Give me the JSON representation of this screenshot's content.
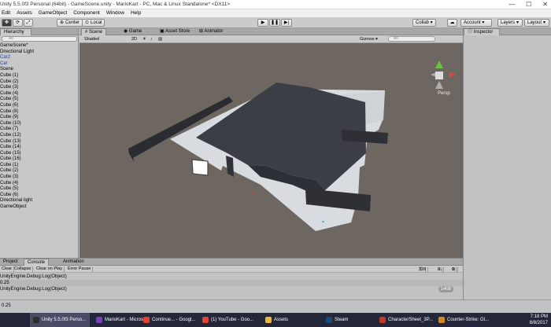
{
  "window": {
    "title": "Unity 5.5.0f3 Personal (64bit) - GameScene.unity - MarioKart - PC, Mac & Linux Standalone* <DX11>",
    "controls": [
      "—",
      "☐",
      "✕"
    ]
  },
  "menu": [
    "Edit",
    "Assets",
    "GameObject",
    "Component",
    "Window",
    "Help"
  ],
  "toolbar": {
    "pivot": "Center",
    "space": "Local",
    "play": "▶",
    "pause": "❚❚",
    "step": "▶|",
    "collab": "Collab ▾",
    "cloud": "☁",
    "account": "Account ▾",
    "layers": "Layers",
    "layout": "Layout"
  },
  "hierarchy": {
    "tab": "Hierarchy",
    "search_placeholder": "All",
    "items": [
      {
        "label": "GameScene*",
        "blue": false
      },
      {
        "label": "Directional Light",
        "blue": false
      },
      {
        "label": "Car2",
        "blue": true
      },
      {
        "label": "Car",
        "blue": true
      },
      {
        "label": "Scene",
        "blue": false
      },
      {
        "label": "Cube (1)",
        "blue": false
      },
      {
        "label": "Cube (2)",
        "blue": false
      },
      {
        "label": "Cube (3)",
        "blue": false
      },
      {
        "label": "Cube (4)",
        "blue": false
      },
      {
        "label": "Cube (5)",
        "blue": false
      },
      {
        "label": "Cube (6)",
        "blue": false
      },
      {
        "label": "Cube (8)",
        "blue": false
      },
      {
        "label": "Cube (9)",
        "blue": false
      },
      {
        "label": "Cube (10)",
        "blue": false
      },
      {
        "label": "Cube (7)",
        "blue": false
      },
      {
        "label": "Cube (12)",
        "blue": false
      },
      {
        "label": "Cube (13)",
        "blue": false
      },
      {
        "label": "Cube (14)",
        "blue": false
      },
      {
        "label": "Cube (15)",
        "blue": false
      },
      {
        "label": "Cube (16)",
        "blue": false
      },
      {
        "label": "Cube (1)",
        "blue": false
      },
      {
        "label": "Cube (2)",
        "blue": false
      },
      {
        "label": "Cube (3)",
        "blue": false
      },
      {
        "label": "Cube (4)",
        "blue": false
      },
      {
        "label": "Cube (5)",
        "blue": false
      },
      {
        "label": "Cube (6)",
        "blue": false
      },
      {
        "label": "Directional light",
        "blue": false
      },
      {
        "label": "GameObject",
        "blue": false
      }
    ]
  },
  "scene": {
    "tabs": [
      "Scene",
      "Game",
      "Asset Store",
      "Animator"
    ],
    "shading": "Shaded",
    "mode_2d": "2D",
    "gizmos": "Gizmos ▾",
    "search_placeholder": "All",
    "persp": "Persp"
  },
  "inspector": {
    "tab": "Inspector"
  },
  "console": {
    "tabs": [
      "Project",
      "Console",
      "Animation"
    ],
    "buttons": [
      "Clear",
      "Collapse",
      "Clear on Play",
      "Error Pause"
    ],
    "counts": {
      "logs": "328",
      "warnings": "0",
      "errors": "0"
    },
    "lines": [
      {
        "text": "UnityEngine.Debug:Log(Object)",
        "count": ""
      },
      {
        "text": "0.25",
        "count": ""
      },
      {
        "text": "UnityEngine.Debug:Log(Object)",
        "count": "1408"
      }
    ],
    "status": "0.25"
  },
  "taskbar": {
    "items": [
      {
        "label": "Unity 5.5.0f3 Perso...",
        "color": "#2f2f2f",
        "active": true
      },
      {
        "label": "MarioKart - Micros...",
        "color": "#7b3fb8",
        "active": false
      },
      {
        "label": "Continue... - Googl...",
        "color": "#e44134",
        "active": false
      },
      {
        "label": "(1) YouTube - Goo...",
        "color": "#e44134",
        "active": false
      },
      {
        "label": "Assets",
        "color": "#e8b83a",
        "active": false
      },
      {
        "label": "Steam",
        "color": "#1b4a7a",
        "active": false
      },
      {
        "label": "CharacterSheet_3P...",
        "color": "#c0392b",
        "active": false
      },
      {
        "label": "Counter-Strike: Gl...",
        "color": "#d28a1f",
        "active": false
      }
    ],
    "time": "7:18 PM",
    "date": "8/8/2017"
  }
}
